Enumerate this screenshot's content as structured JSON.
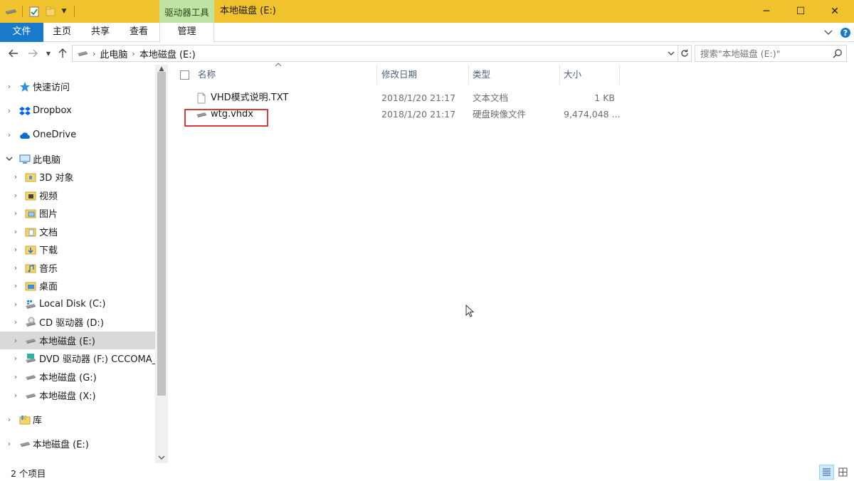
{
  "titlebar": {
    "tool_tab": "驱动器工具",
    "window_title": "本地磁盘 (E:)",
    "minimize": "─",
    "maximize": "☐",
    "close": "✕"
  },
  "ribbon": {
    "tabs": [
      "文件",
      "主页",
      "共享",
      "查看",
      "管理"
    ]
  },
  "address": {
    "crumbs": [
      "此电脑",
      "本地磁盘 (E:)"
    ],
    "search_placeholder": "搜索\"本地磁盘 (E:)\""
  },
  "nav": {
    "quick_access": "快速访问",
    "dropbox": "Dropbox",
    "onedrive": "OneDrive",
    "this_pc": "此电脑",
    "objects3d": "3D 对象",
    "videos": "视频",
    "pictures": "图片",
    "documents": "文档",
    "downloads": "下载",
    "music": "音乐",
    "desktop": "桌面",
    "drive_c": "Local Disk (C:)",
    "drive_d": "CD 驱动器 (D:)",
    "drive_e": "本地磁盘 (E:)",
    "drive_f": "DVD 驱动器 (F:) CCCOMA_X",
    "drive_g": "本地磁盘 (G:)",
    "drive_x": "本地磁盘 (X:)",
    "libraries": "库",
    "drive_e2": "本地磁盘 (E:)"
  },
  "columns": {
    "name": "名称",
    "modified": "修改日期",
    "type": "类型",
    "size": "大小"
  },
  "files": [
    {
      "name": "VHD模式说明.TXT",
      "modified": "2018/1/20 21:17",
      "type": "文本文档",
      "size": "1 KB",
      "icon": "text-file-icon"
    },
    {
      "name": "wtg.vhdx",
      "modified": "2018/1/20 21:17",
      "type": "硬盘映像文件",
      "size": "9,474,048 ...",
      "icon": "disk-image-icon"
    }
  ],
  "status": {
    "count": "2 个项目"
  }
}
